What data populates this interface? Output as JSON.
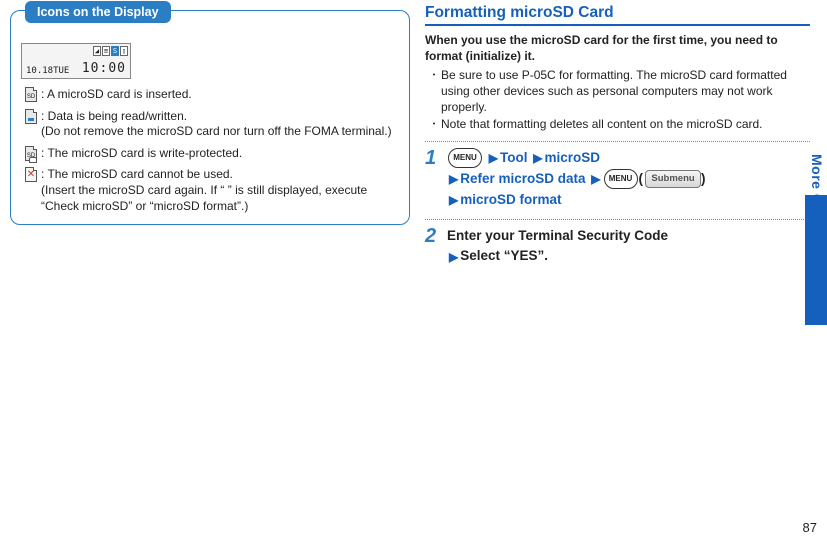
{
  "left": {
    "tab_title": "Icons on the Display",
    "display_time": "10:00",
    "display_date": "10.18TUE",
    "rows": [
      {
        "lead": ": A microSD card is inserted.",
        "sub": ""
      },
      {
        "lead": ": Data is being read/written.",
        "sub": "(Do not remove the microSD card nor turn off the FOMA terminal.)"
      },
      {
        "lead": ": The microSD card is write-protected.",
        "sub": ""
      },
      {
        "lead": ": The microSD card cannot be used.",
        "sub": "(Insert the microSD card again. If “   ” is still displayed, execute “Check microSD” or “microSD format”.)"
      }
    ]
  },
  "right": {
    "title": "Formatting microSD Card",
    "intro": "When you use the microSD card for the first time, you need to format (initialize) it.",
    "bullets": [
      "Be sure to use P-05C for formatting. The microSD card formatted using other devices such as personal computers may not work properly.",
      "Note that formatting deletes all content on the microSD card."
    ],
    "step1": {
      "num": "1",
      "menu_label": "MENU",
      "tool": "Tool",
      "microsd": "microSD",
      "refer": "Refer microSD data",
      "submenu_label": "Submenu",
      "format": "microSD format"
    },
    "step2": {
      "num": "2",
      "line1": "Enter your Terminal Security Code",
      "line2": "Select “YES”."
    }
  },
  "side_label": "More Convenient",
  "page_number": "87"
}
